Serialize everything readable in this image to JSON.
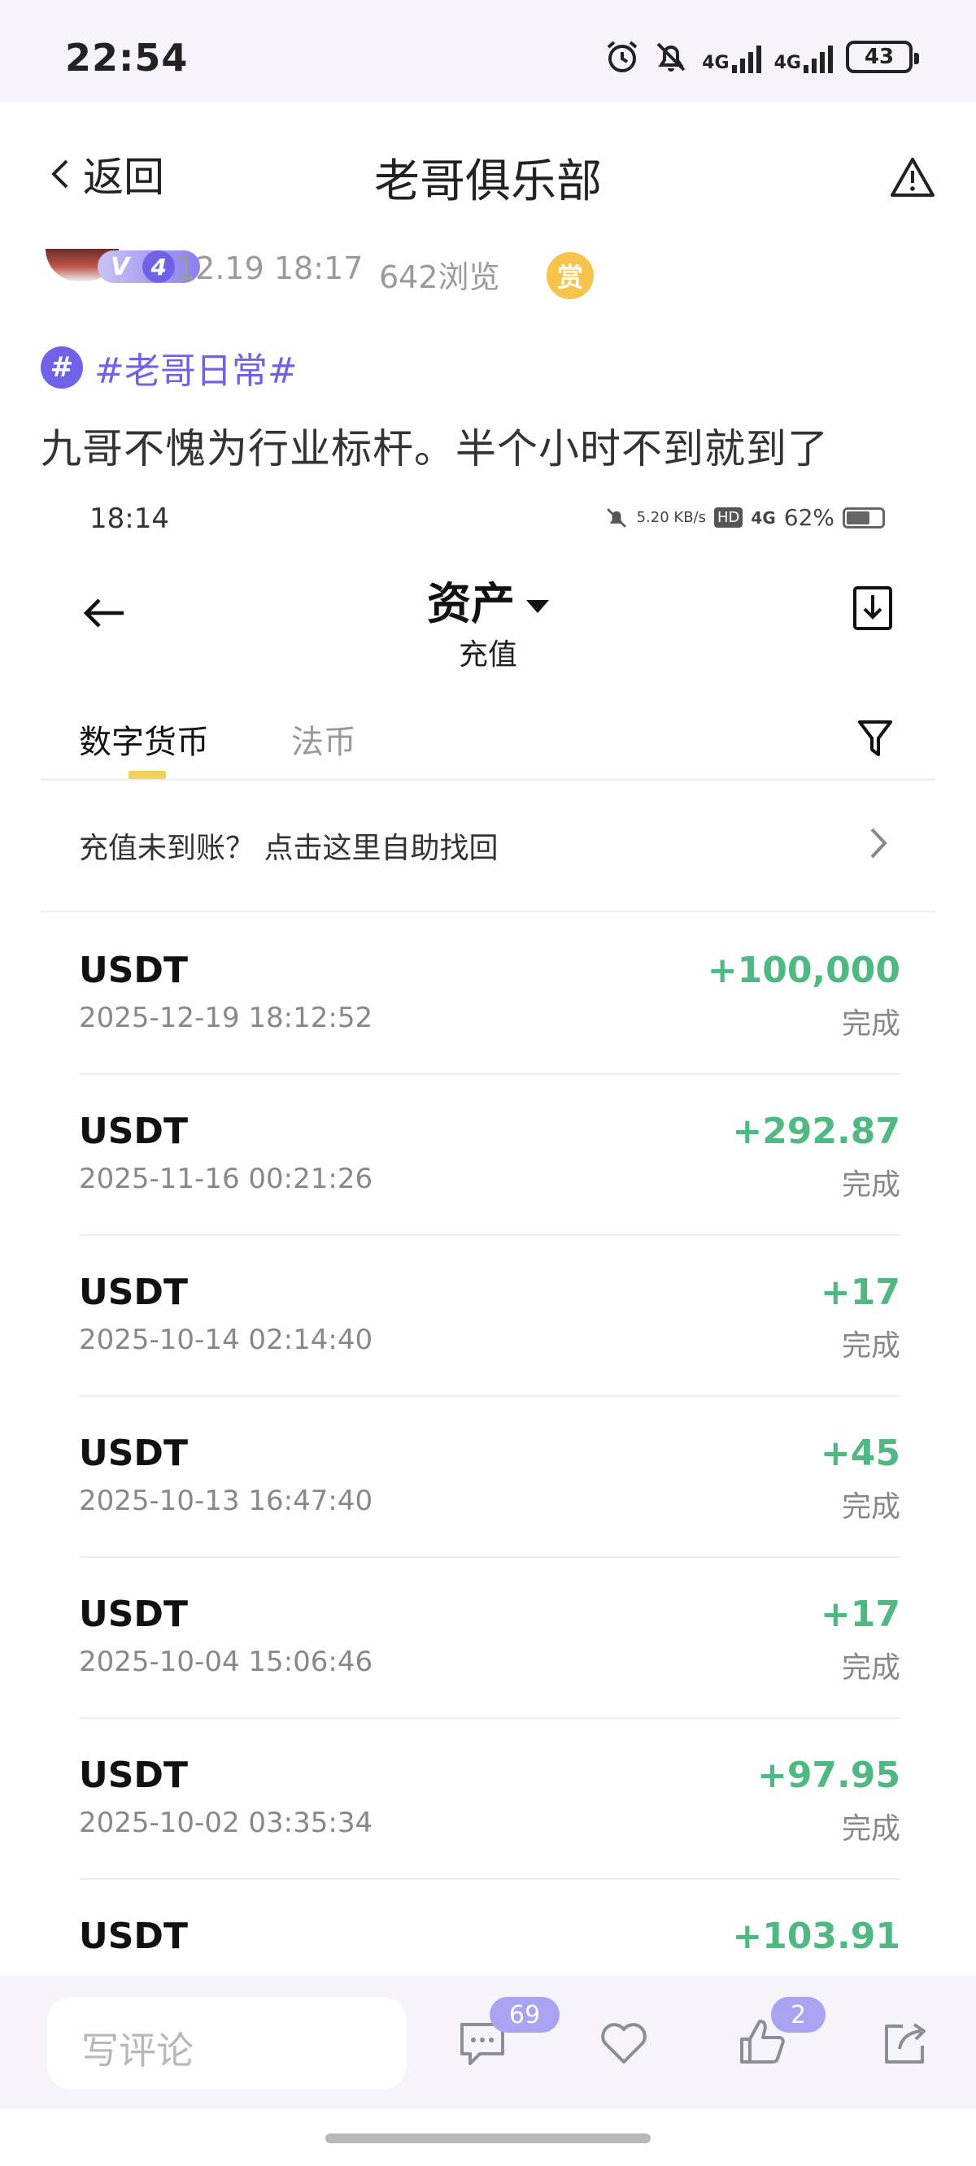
{
  "status_bar": {
    "time": "22:54",
    "net1": "4G",
    "net2": "4G",
    "battery": "43"
  },
  "nav": {
    "back_label": "返回",
    "title": "老哥俱乐部"
  },
  "post": {
    "vip_letter": "V",
    "vip_level": "4",
    "time": "12.19 18:17",
    "views": "642浏览",
    "reward_label": "赏",
    "topic_symbol": "#",
    "topic": "#老哥日常#",
    "text": "九哥不愧为行业标杆。半个小时不到就到了"
  },
  "screenshot": {
    "status": {
      "time": "18:14",
      "speed": "5.20 KB/s",
      "hd": "HD",
      "net": "4G",
      "battery": "62%"
    },
    "header": {
      "title": "资产",
      "subtitle": "充值"
    },
    "tabs": {
      "active": "数字货币",
      "inactive": "法币"
    },
    "banner": "充值未到账？ 点击这里自助找回",
    "transactions": [
      {
        "coin": "USDT",
        "date": "2025-12-19 18:12:52",
        "amount": "+100,000",
        "status": "完成"
      },
      {
        "coin": "USDT",
        "date": "2025-11-16 00:21:26",
        "amount": "+292.87",
        "status": "完成"
      },
      {
        "coin": "USDT",
        "date": "2025-10-14 02:14:40",
        "amount": "+17",
        "status": "完成"
      },
      {
        "coin": "USDT",
        "date": "2025-10-13 16:47:40",
        "amount": "+45",
        "status": "完成"
      },
      {
        "coin": "USDT",
        "date": "2025-10-04 15:06:46",
        "amount": "+17",
        "status": "完成"
      },
      {
        "coin": "USDT",
        "date": "2025-10-02 03:35:34",
        "amount": "+97.95",
        "status": "完成"
      },
      {
        "coin": "USDT",
        "date": "",
        "amount": "+103.91",
        "status": ""
      }
    ]
  },
  "bottom_bar": {
    "comment_placeholder": "写评论",
    "comment_count": "69",
    "like_count": "2"
  },
  "colors": {
    "accent": "#6f62e8",
    "positive": "#4fb883",
    "tab_underline": "#f2d25a"
  },
  "icons": [
    "alarm-icon",
    "mute-icon",
    "signal-icon",
    "battery-icon",
    "back-icon",
    "warning-icon",
    "topic-icon",
    "download-icon",
    "filter-icon",
    "chevron-right-icon",
    "comment-icon",
    "heart-icon",
    "thumbs-up-icon",
    "share-icon"
  ]
}
